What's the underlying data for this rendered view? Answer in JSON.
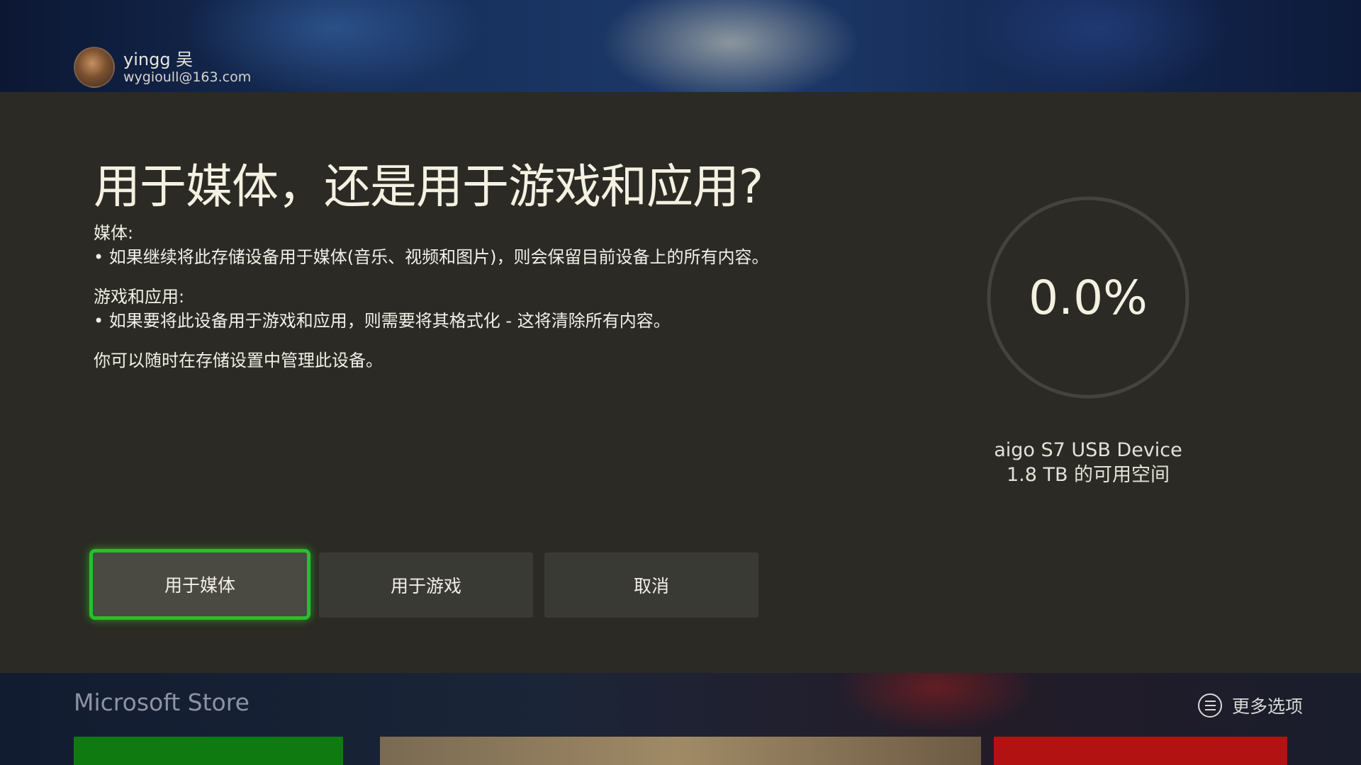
{
  "profile": {
    "name": "yingg 吴",
    "email": "wygioull@163.com"
  },
  "dialog": {
    "title": "用于媒体，还是用于游戏和应用?",
    "media_heading": "媒体:",
    "media_text": "• 如果继续将此存储设备用于媒体(音乐、视频和图片)，则会保留目前设备上的所有内容。",
    "games_heading": "游戏和应用:",
    "games_text": "• 如果要将此设备用于游戏和应用，则需要将其格式化 - 这将清除所有内容。",
    "manage_note": "你可以随时在存储设置中管理此设备。",
    "progress_label": "0.0%",
    "progress_fraction": 0.0,
    "device_name": "aigo S7 USB Device",
    "device_space": "1.8 TB 的可用空间",
    "buttons": {
      "media": "用于媒体",
      "games": "用于游戏",
      "cancel": "取消"
    }
  },
  "footer": {
    "store_label": "Microsoft Store",
    "more_options": "更多选项"
  },
  "colors": {
    "dialog_bg": "#2b2a24",
    "focus_green": "#27c02a",
    "button_bg": "#3a3a35"
  }
}
